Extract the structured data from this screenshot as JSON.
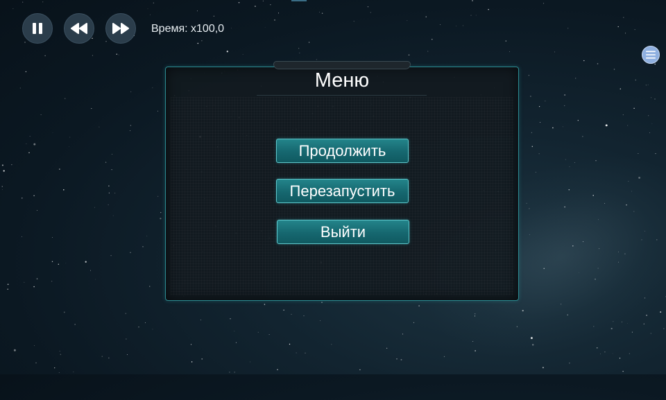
{
  "hud": {
    "pause_icon": "pause-icon",
    "rewind_icon": "rewind-icon",
    "fast_forward_icon": "fast-forward-icon",
    "time_label": "Время: x100,0",
    "menu_icon": "hamburger-menu-icon"
  },
  "menu": {
    "title": "Меню",
    "buttons": [
      {
        "label": "Продолжить"
      },
      {
        "label": "Перезапустить"
      },
      {
        "label": "Выйти"
      }
    ]
  },
  "colors": {
    "accent": "#1b7880",
    "button_border": "#5ec8cc",
    "panel_border": "#2c8a90",
    "hud_button": "#2b3d4b",
    "menu_toggle": "#8fb0e0"
  }
}
